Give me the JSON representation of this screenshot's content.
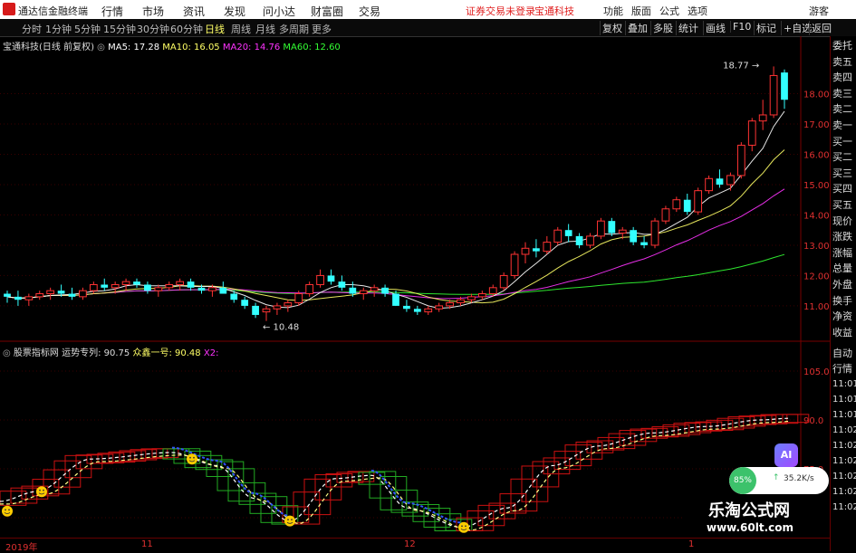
{
  "menubar": {
    "app_title": "通达信金融终端",
    "menus": [
      "行情",
      "市场",
      "资讯",
      "发现",
      "问小达",
      "财富圈",
      "交易"
    ],
    "notice_1": "证券交易未登录",
    "notice_2": "宝通科技",
    "right": [
      "功能",
      "版面",
      "公式",
      "选项",
      "游客"
    ]
  },
  "toolbar": {
    "periods": [
      "分时",
      "1分钟",
      "5分钟",
      "15分钟",
      "30分钟",
      "60分钟",
      "日线",
      "周线",
      "月线",
      "多周期",
      "更多"
    ],
    "selected": "日线",
    "buttons": [
      "复权",
      "叠加",
      "多股",
      "统计",
      "画线",
      "F10",
      "标记",
      "+自选",
      "返回"
    ]
  },
  "main_legend": {
    "stock": "宝通科技(日线 前复权)",
    "ma5": "MA5: 17.28",
    "ma10": "MA10: 16.05",
    "ma20": "MA20: 14.76",
    "ma60": "MA60: 12.60",
    "high_label": "18.77",
    "low_label": "10.48"
  },
  "sub_legend": {
    "name": "股票指标网",
    "l1": "运势专列: 90.75",
    "l2": "众鑫一号: 90.48",
    "l3": "X2:"
  },
  "side_panel": {
    "items": [
      "委托",
      "卖五",
      "卖四",
      "卖三",
      "卖二",
      "卖一",
      "买一",
      "买二",
      "买三",
      "买四",
      "买五",
      "现价",
      "涨跌",
      "涨幅",
      "总量",
      "外盘",
      "换手",
      "净资",
      "收益"
    ],
    "lower": [
      "自动",
      "行情",
      "11:01",
      "11:01",
      "11:01",
      "11:02",
      "11:02",
      "11:02",
      "11:02",
      "11:02",
      "11:02"
    ]
  },
  "x_labels": [
    "2019年",
    "11",
    "12",
    "1"
  ],
  "ai_badge": "AI",
  "widget": {
    "percent": "85%",
    "speed": "35.2K/s"
  },
  "watermark": {
    "title": "乐淘公式网",
    "url": "www.60lt.com"
  },
  "colors": {
    "up": "#ff3333",
    "down": "#33ffff",
    "ma5": "#ffffff",
    "ma10": "#ffff66",
    "ma20": "#ff33ff",
    "ma60": "#33ff33"
  },
  "chart_data": [
    {
      "type": "candlestick",
      "title": "宝通科技(日线 前复权)",
      "ylim": [
        10.4,
        19.3
      ],
      "yticks": [
        11.0,
        12.0,
        13.0,
        14.0,
        15.0,
        16.0,
        17.0,
        18.0
      ],
      "ohlc": [
        [
          11.4,
          11.5,
          11.1,
          11.3
        ],
        [
          11.3,
          11.5,
          11.0,
          11.2
        ],
        [
          11.2,
          11.4,
          11.0,
          11.3
        ],
        [
          11.3,
          11.5,
          11.2,
          11.4
        ],
        [
          11.4,
          11.6,
          11.2,
          11.5
        ],
        [
          11.5,
          11.7,
          11.3,
          11.4
        ],
        [
          11.4,
          11.6,
          11.2,
          11.3
        ],
        [
          11.3,
          11.6,
          11.2,
          11.5
        ],
        [
          11.5,
          11.8,
          11.4,
          11.7
        ],
        [
          11.7,
          11.9,
          11.5,
          11.6
        ],
        [
          11.6,
          11.8,
          11.4,
          11.7
        ],
        [
          11.7,
          11.9,
          11.5,
          11.8
        ],
        [
          11.8,
          11.9,
          11.6,
          11.7
        ],
        [
          11.7,
          11.8,
          11.4,
          11.5
        ],
        [
          11.5,
          11.7,
          11.3,
          11.6
        ],
        [
          11.6,
          11.8,
          11.5,
          11.7
        ],
        [
          11.7,
          11.9,
          11.5,
          11.8
        ],
        [
          11.8,
          11.9,
          11.5,
          11.6
        ],
        [
          11.6,
          11.7,
          11.4,
          11.5
        ],
        [
          11.5,
          11.7,
          11.3,
          11.6
        ],
        [
          11.6,
          11.8,
          11.4,
          11.4
        ],
        [
          11.4,
          11.5,
          11.1,
          11.2
        ],
        [
          11.2,
          11.3,
          10.9,
          11.0
        ],
        [
          11.0,
          11.1,
          10.6,
          10.7
        ],
        [
          10.8,
          11.0,
          10.5,
          10.9
        ],
        [
          10.9,
          11.1,
          10.7,
          11.0
        ],
        [
          11.0,
          11.2,
          10.8,
          11.1
        ],
        [
          11.1,
          11.5,
          11.0,
          11.4
        ],
        [
          11.4,
          11.8,
          11.3,
          11.7
        ],
        [
          11.7,
          12.2,
          11.6,
          12.0
        ],
        [
          12.0,
          12.2,
          11.7,
          11.8
        ],
        [
          11.8,
          12.0,
          11.5,
          11.6
        ],
        [
          11.6,
          11.8,
          11.3,
          11.4
        ],
        [
          11.4,
          11.6,
          11.2,
          11.5
        ],
        [
          11.5,
          11.7,
          11.3,
          11.6
        ],
        [
          11.6,
          11.7,
          11.3,
          11.4
        ],
        [
          11.4,
          11.5,
          11.0,
          11.0
        ],
        [
          11.0,
          11.2,
          10.8,
          10.9
        ],
        [
          10.9,
          11.0,
          10.7,
          10.8
        ],
        [
          10.8,
          11.0,
          10.7,
          10.9
        ],
        [
          10.9,
          11.1,
          10.8,
          11.0
        ],
        [
          11.0,
          11.2,
          10.9,
          11.1
        ],
        [
          11.1,
          11.3,
          11.0,
          11.2
        ],
        [
          11.2,
          11.4,
          11.1,
          11.3
        ],
        [
          11.3,
          11.5,
          11.2,
          11.4
        ],
        [
          11.4,
          11.7,
          11.3,
          11.6
        ],
        [
          11.6,
          12.1,
          11.5,
          12.0
        ],
        [
          12.0,
          12.8,
          11.9,
          12.7
        ],
        [
          12.7,
          13.1,
          12.4,
          12.9
        ],
        [
          12.9,
          13.2,
          12.6,
          12.8
        ],
        [
          12.8,
          13.3,
          12.7,
          13.1
        ],
        [
          13.1,
          13.6,
          13.0,
          13.5
        ],
        [
          13.5,
          13.7,
          13.1,
          13.3
        ],
        [
          13.3,
          13.4,
          12.9,
          13.0
        ],
        [
          13.0,
          13.4,
          12.9,
          13.3
        ],
        [
          13.3,
          13.9,
          13.2,
          13.8
        ],
        [
          13.8,
          13.9,
          13.3,
          13.4
        ],
        [
          13.4,
          13.6,
          13.2,
          13.5
        ],
        [
          13.5,
          13.6,
          13.0,
          13.1
        ],
        [
          13.1,
          13.3,
          12.9,
          13.0
        ],
        [
          13.0,
          13.9,
          12.9,
          13.8
        ],
        [
          13.8,
          14.3,
          13.7,
          14.2
        ],
        [
          14.2,
          14.6,
          14.1,
          14.5
        ],
        [
          14.5,
          14.7,
          14.0,
          14.1
        ],
        [
          14.1,
          14.9,
          14.0,
          14.8
        ],
        [
          14.8,
          15.3,
          14.7,
          15.2
        ],
        [
          15.2,
          15.5,
          14.9,
          15.0
        ],
        [
          15.0,
          15.4,
          14.8,
          15.3
        ],
        [
          15.3,
          16.4,
          15.2,
          16.3
        ],
        [
          16.3,
          17.2,
          16.1,
          17.1
        ],
        [
          17.1,
          17.8,
          16.8,
          17.3
        ],
        [
          17.3,
          18.9,
          17.2,
          18.6
        ],
        [
          18.7,
          18.8,
          17.5,
          17.8
        ]
      ]
    },
    {
      "type": "line",
      "title": "股票指标网",
      "ylim": [
        55,
        110
      ],
      "yticks": [
        60.0,
        75.0,
        90.0,
        105.0
      ]
    }
  ]
}
